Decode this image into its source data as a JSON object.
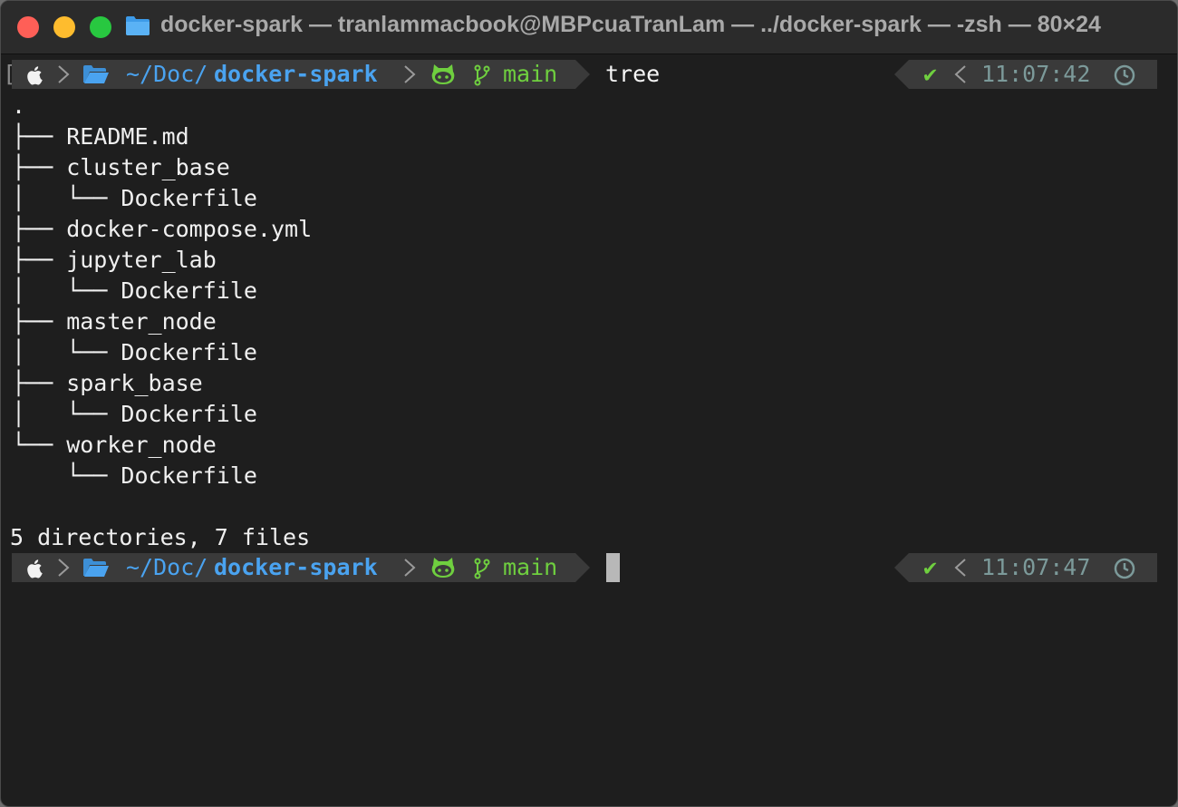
{
  "window": {
    "title": "docker-spark — tranlammacbook@MBPcuaTranLam — ../docker-spark — -zsh — 80×24"
  },
  "prompt1": {
    "bracket": "[",
    "path_prefix": "~/Doc/",
    "path_dir": "docker-spark",
    "branch": "main",
    "command": "tree",
    "status_check": "✔",
    "time": "11:07:42"
  },
  "output": {
    "lines": [
      ".",
      "├── README.md",
      "├── cluster_base",
      "│   └── Dockerfile",
      "├── docker-compose.yml",
      "├── jupyter_lab",
      "│   └── Dockerfile",
      "├── master_node",
      "│   └── Dockerfile",
      "├── spark_base",
      "│   └── Dockerfile",
      "└── worker_node",
      "    └── Dockerfile",
      "",
      "5 directories, 7 files"
    ]
  },
  "prompt2": {
    "path_prefix": "~/Doc/",
    "path_dir": "docker-spark",
    "branch": "main",
    "status_check": "✔",
    "time": "11:07:47"
  },
  "colors": {
    "accent_blue": "#4aa3f0",
    "path_gray": "#8e8ea8",
    "git_green": "#6fcf3f",
    "time_gray": "#7c9a9a",
    "segment_bg": "#3a3a3a",
    "terminal_bg": "#1e1e1e"
  },
  "icons": [
    "apple-icon",
    "folder-icon",
    "github-octocat-icon",
    "git-branch-icon",
    "checkmark-icon",
    "clock-icon"
  ]
}
